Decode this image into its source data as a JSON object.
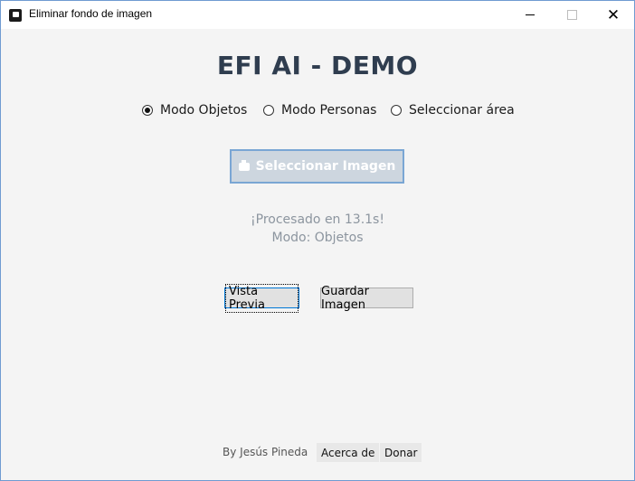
{
  "window": {
    "title": "Eliminar fondo de imagen",
    "app_icon": "shirt-icon",
    "close_glyph": "✕"
  },
  "heading": "EFI AI - DEMO",
  "modes": [
    {
      "label": "Modo Objetos",
      "selected": true
    },
    {
      "label": "Modo Personas",
      "selected": false
    },
    {
      "label": "Seleccionar área",
      "selected": false
    }
  ],
  "select_button": {
    "label": "Seleccionar Imagen",
    "icon": "camera-icon"
  },
  "status": {
    "processed": "¡Procesado en 13.1s!",
    "mode": "Modo: Objetos"
  },
  "actions": {
    "preview": "Vista Previa",
    "save": "Guardar Imagen"
  },
  "footer": {
    "author": "By Jesús Pineda",
    "about": "Acerca de",
    "donate": "Donar"
  },
  "colors": {
    "heading": "#2f3d4f",
    "status_text": "#8c959f",
    "button_border": "#7aa6d4"
  }
}
